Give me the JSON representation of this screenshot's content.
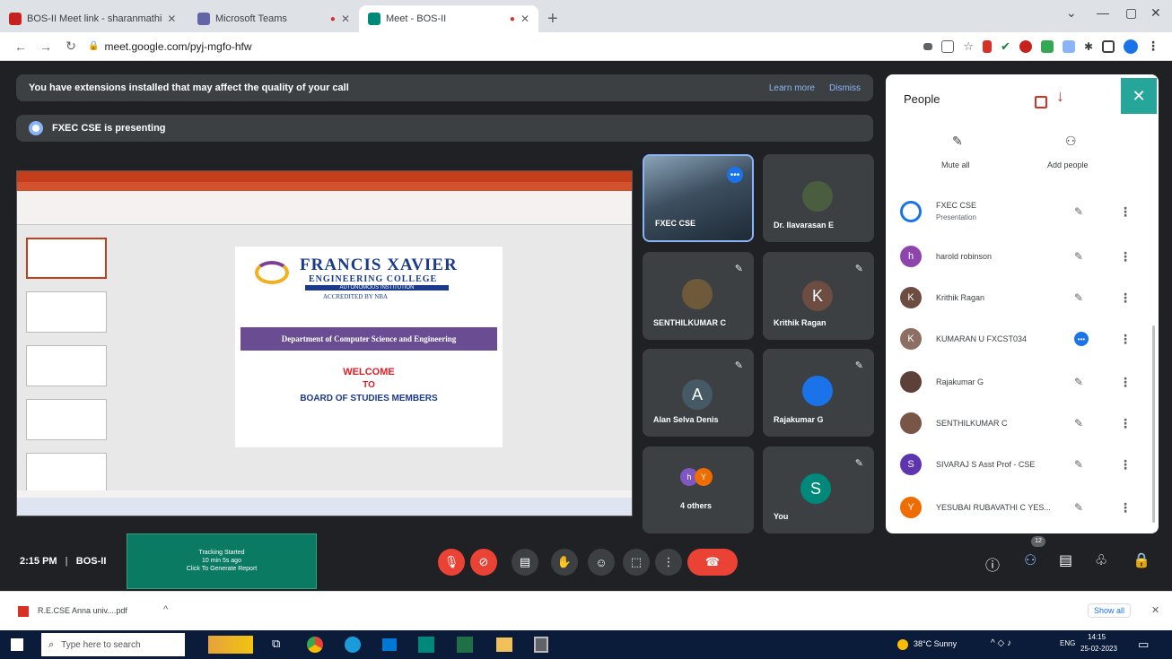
{
  "browser": {
    "tabs": [
      {
        "label": "BOS-II Meet link - sharanmathi",
        "color": "#c5221f",
        "active": false
      },
      {
        "label": "Microsoft Teams",
        "color": "#6264a7",
        "active": false
      },
      {
        "label": "Meet - BOS-II",
        "color": "#00897b",
        "active": true
      }
    ],
    "url": "meet.google.com/pyj-mgfo-hfw"
  },
  "banner": {
    "extensions_text": "You have extensions installed that may affect the quality of your call",
    "learn_more": "Learn more",
    "dismiss": "Dismiss",
    "presenting": "FXEC CSE is presenting"
  },
  "slide": {
    "college_name": "FRANCIS XAVIER",
    "college_sub": "ENGINEERING COLLEGE",
    "autonomous": "AUTONOMOUS INSTITUTION",
    "accredited": "ACCREDITED BY NBA",
    "department": "Department of Computer Science and Engineering",
    "welcome": "WELCOME",
    "to": "TO",
    "board": "BOARD OF STUDIES MEMBERS"
  },
  "tiles": [
    {
      "name": "FXEC CSE"
    },
    {
      "name": "Dr. Ilavarasan E"
    },
    {
      "name": "SENTHILKUMAR C"
    },
    {
      "name": "Krithik Ragan",
      "initial": "K"
    },
    {
      "name": "Alan Selva Denis",
      "initial": "A"
    },
    {
      "name": "Rajakumar G"
    },
    {
      "name": "4 others"
    },
    {
      "name": "You",
      "initial": "S"
    }
  ],
  "people_panel": {
    "title": "People",
    "mute_all": "Mute all",
    "add_people": "Add people",
    "participants": [
      {
        "name": "FXEC CSE",
        "sub": "Presentation",
        "initial": "",
        "color": "#1a73e8"
      },
      {
        "name": "harold robinson",
        "initial": "h",
        "color": "#8e44ad"
      },
      {
        "name": "Krithik Ragan",
        "initial": "K",
        "color": "#6d4c41"
      },
      {
        "name": "KUMARAN U FXCST034",
        "initial": "K",
        "color": "#8d6e63"
      },
      {
        "name": "Rajakumar G",
        "initial": "",
        "color": "#5d4037"
      },
      {
        "name": "SENTHILKUMAR C",
        "initial": "",
        "color": "#795548"
      },
      {
        "name": "SIVARAJ S Asst Prof - CSE",
        "initial": "S",
        "color": "#5e35b1"
      },
      {
        "name": "YESUBAI RUBAVATHI C YES...",
        "initial": "Y",
        "color": "#ef6c00"
      }
    ]
  },
  "bottom_bar": {
    "time": "2:15 PM",
    "meeting": "BOS-II",
    "tracking_title": "Tracking Started",
    "tracking_sub": "10 min 5s ago",
    "tracking_cta": "Click To Generate Report",
    "people_count": "12"
  },
  "download": {
    "file": "R.E.CSE Anna univ....pdf",
    "show_all": "Show all"
  },
  "taskbar": {
    "search": "Type here to search",
    "weather": "38°C Sunny",
    "lang": "ENG",
    "time": "14:15",
    "date": "25-02-2023"
  }
}
